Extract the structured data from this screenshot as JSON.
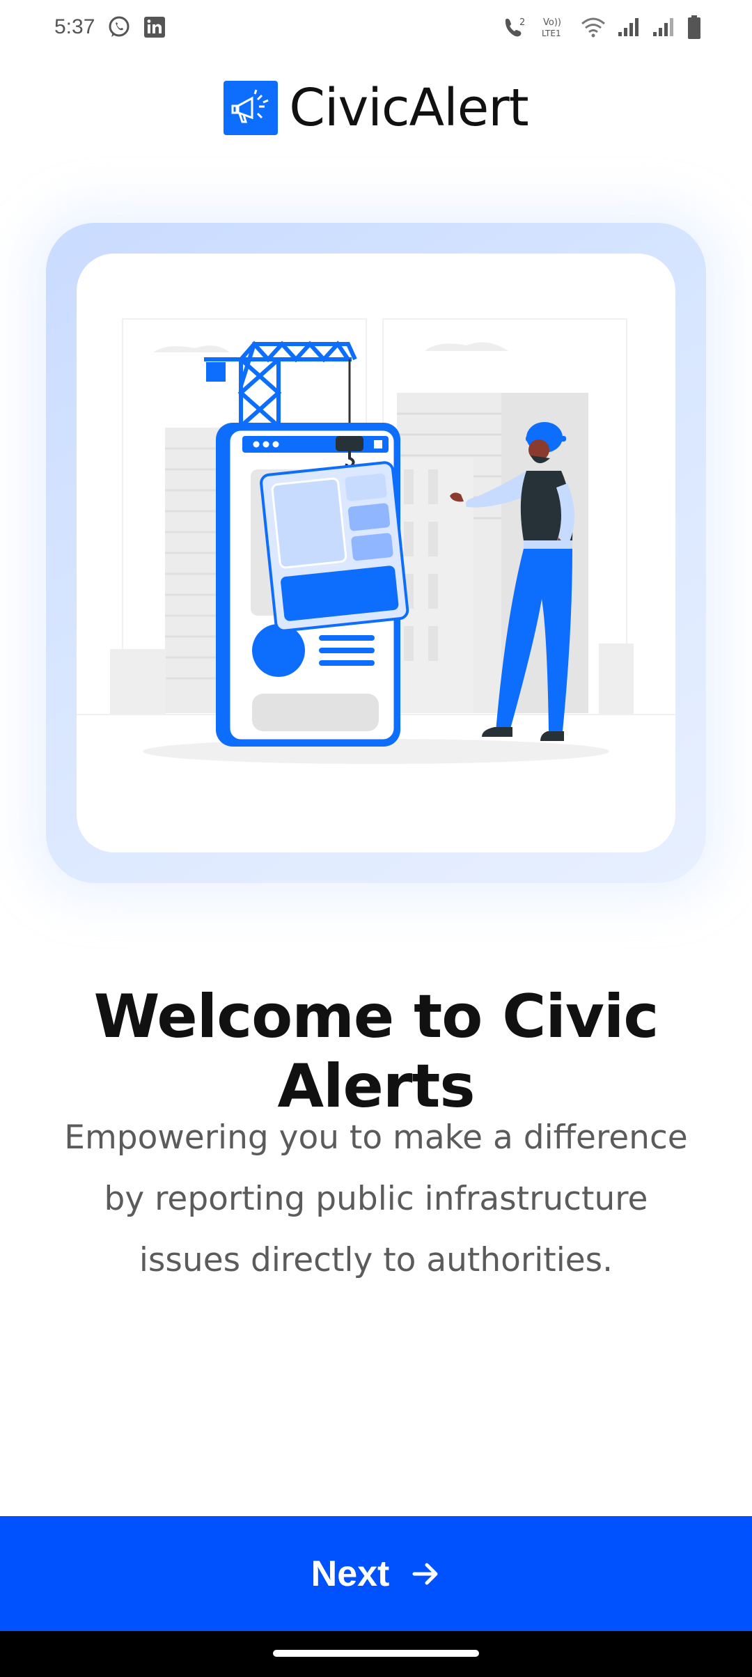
{
  "status_bar": {
    "time": "5:37",
    "left_icons": [
      "whatsapp-icon",
      "linkedin-icon"
    ],
    "right_icons": [
      "wifi-calling-icon",
      "volte-icon",
      "wifi-icon",
      "signal-icon",
      "signal-icon",
      "battery-icon"
    ],
    "call_badge": "2",
    "volte_label": "Vo))",
    "lte_label": "LTE1"
  },
  "header": {
    "app_name": "CivicAlert",
    "logo_icon": "megaphone-icon"
  },
  "hero": {
    "illustration": "construction-worker-phone-illustration"
  },
  "content": {
    "title": "Welcome to Civic Alerts",
    "description": "Empowering you to make a difference by reporting public infrastructure issues directly to authorities."
  },
  "footer": {
    "next_label": "Next",
    "next_icon": "arrow-right-icon"
  },
  "colors": {
    "brand": "#0d6efd",
    "button": "#0051ff",
    "title": "#111111",
    "description": "#5b5b5b",
    "card_gradient": "#c9dbff"
  }
}
